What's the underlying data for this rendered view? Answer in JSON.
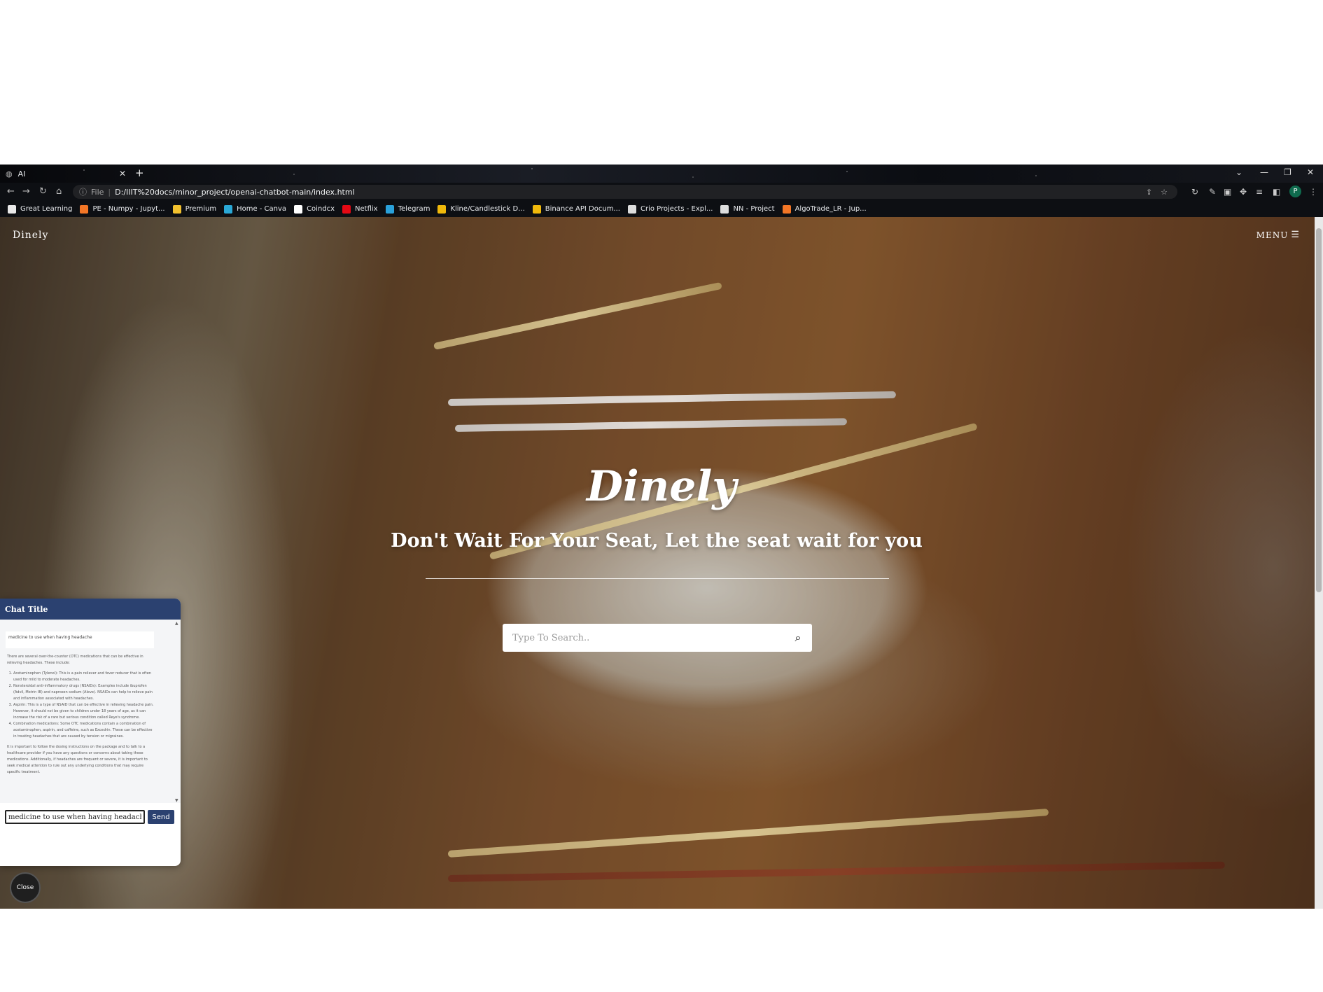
{
  "browser": {
    "tab_title": "AI",
    "address": {
      "scheme_label": "File",
      "url": "D:/IIIT%20docs/minor_project/openai-chatbot-main/index.html"
    },
    "profile_initial": "P",
    "bookmarks": [
      {
        "label": "Great Learning",
        "icon": "great-learning-icon",
        "color": "#e9e9e9"
      },
      {
        "label": "PE - Numpy - Jupyt...",
        "icon": "jupyter-icon",
        "color": "#f37626"
      },
      {
        "label": "Premium",
        "icon": "check-icon",
        "color": "#f2c12e"
      },
      {
        "label": "Home - Canva",
        "icon": "canva-icon",
        "color": "#2aa8d6"
      },
      {
        "label": "Coindcx",
        "icon": "coindcx-icon",
        "color": "#ffffff"
      },
      {
        "label": "Netflix",
        "icon": "netflix-icon",
        "color": "#e50914"
      },
      {
        "label": "Telegram",
        "icon": "telegram-icon",
        "color": "#2aa1da"
      },
      {
        "label": "Kline/Candlestick D...",
        "icon": "binance-icon",
        "color": "#f0b90b"
      },
      {
        "label": "Binance API Docum...",
        "icon": "binance-icon",
        "color": "#f0b90b"
      },
      {
        "label": "Crio Projects - Expl...",
        "icon": "crio-icon",
        "color": "#dddddd"
      },
      {
        "label": "NN - Project",
        "icon": "github-icon",
        "color": "#dddddd"
      },
      {
        "label": "AlgoTrade_LR - Jup...",
        "icon": "jupyter-icon",
        "color": "#f37626"
      }
    ]
  },
  "site": {
    "logo": "Dinely",
    "menu_label": "MENU",
    "hero_title": "Dinely",
    "hero_subtitle": "Don't Wait For Your Seat, Let the seat wait for you",
    "search_placeholder": "Type To Search.."
  },
  "chat": {
    "title": "Chat Title",
    "user_message": "medicine to use when having headache",
    "bot_intro": "There are several over-the-counter (OTC) medications that can be effective in relieving headaches. These include:",
    "bot_items": [
      "Acetaminophen (Tylenol): This is a pain reliever and fever reducer that is often used for mild to moderate headaches.",
      "Nonsteroidal anti-inflammatory drugs (NSAIDs): Examples include ibuprofen (Advil, Motrin IB) and naproxen sodium (Aleve). NSAIDs can help to relieve pain and inflammation associated with headaches.",
      "Aspirin: This is a type of NSAID that can be effective in relieving headache pain. However, it should not be given to children under 18 years of age, as it can increase the risk of a rare but serious condition called Reye's syndrome.",
      "Combination medications: Some OTC medications contain a combination of acetaminophen, aspirin, and caffeine, such as Excedrin. These can be effective in treating headaches that are caused by tension or migraines."
    ],
    "bot_outro": "It is important to follow the dosing instructions on the package and to talk to a healthcare provider if you have any questions or concerns about taking these medications. Additionally, if headaches are frequent or severe, it is important to seek medical attention to rule out any underlying conditions that may require specific treatment.",
    "input_value": "medicine to use when having headache",
    "send_label": "Send",
    "close_label": "Close"
  },
  "colors": {
    "chat_header": "#2b4170",
    "send_button": "#2b4170"
  }
}
